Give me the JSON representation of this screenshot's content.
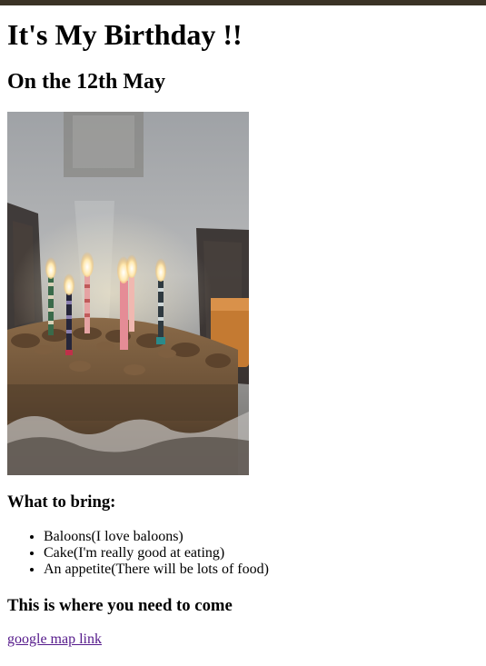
{
  "page": {
    "title": "It's My Birthday !!",
    "subtitle": "On the 12th May"
  },
  "photo": {
    "icon": "birthday-cake-with-candles-photo"
  },
  "bring": {
    "heading": "What to bring:",
    "items": [
      "Baloons(I love baloons)",
      "Cake(I'm really good at eating)",
      "An appetite(There will be lots of food)"
    ]
  },
  "location": {
    "heading": "This is where you need to come",
    "link_text": "google map link"
  },
  "colors": {
    "link_visited": "#551a8b",
    "top_strip": "#3b3326"
  }
}
